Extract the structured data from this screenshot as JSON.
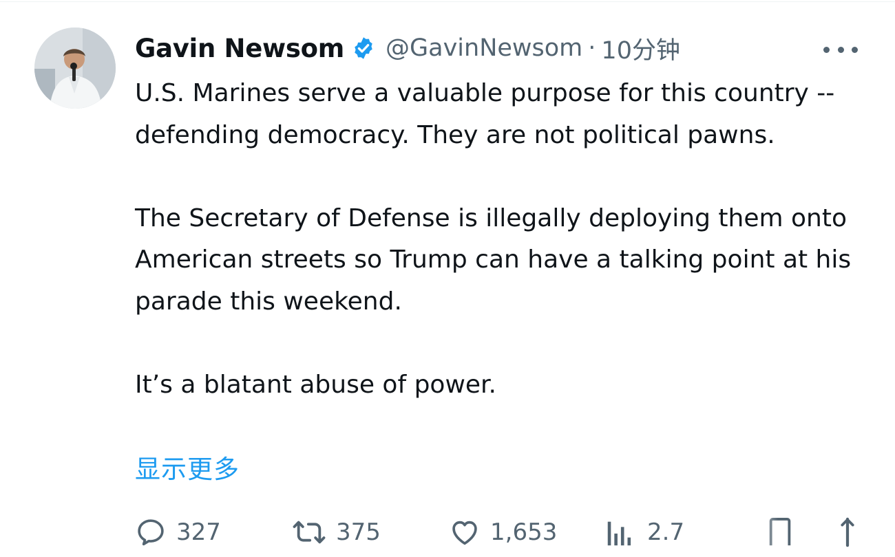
{
  "tweet": {
    "author_name": "Gavin Newsom",
    "handle": "@GavinNewsom",
    "separator": "·",
    "timestamp": "10分钟",
    "verified": true,
    "paragraphs": [
      "U.S. Marines serve a valuable purpose for this country -- defending democracy. They are not political pawns.",
      "The Secretary of Defense is illegally deploying them onto American streets so Trump can have a talking point at his parade this weekend.",
      "It’s a blatant abuse of power."
    ],
    "show_more_label": "显示更多"
  },
  "actions": {
    "replies": "327",
    "retweets": "375",
    "likes": "1,653",
    "views": "2.7"
  },
  "icons": {
    "verified": "verified-badge-icon",
    "more": "more-dots-icon",
    "reply": "reply-icon",
    "retweet": "retweet-icon",
    "like": "heart-icon",
    "views": "views-chart-icon",
    "bookmark": "bookmark-icon",
    "share": "share-icon"
  },
  "colors": {
    "text": "#0f1419",
    "secondary": "#536471",
    "accent": "#1d9bf0"
  }
}
